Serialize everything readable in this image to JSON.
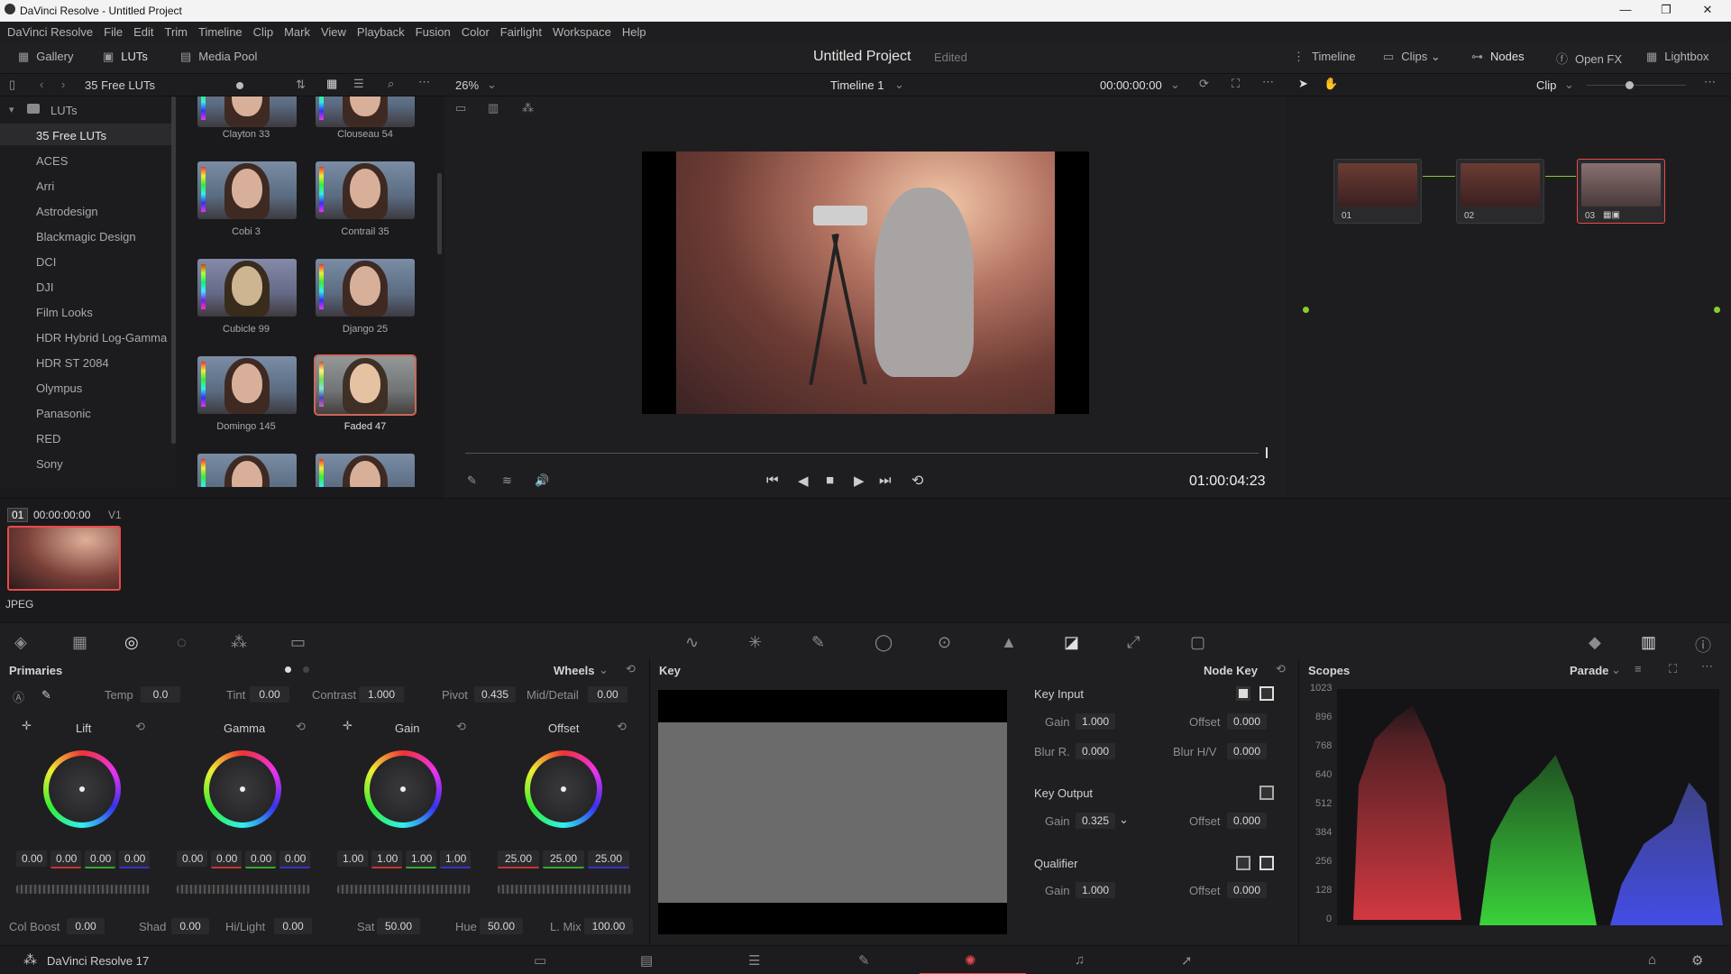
{
  "window": {
    "title": "DaVinci Resolve - Untitled Project",
    "minimize": "—",
    "maximize": "❐",
    "close": "✕"
  },
  "menu": [
    "DaVinci Resolve",
    "File",
    "Edit",
    "Trim",
    "Timeline",
    "Clip",
    "Mark",
    "View",
    "Playback",
    "Fusion",
    "Color",
    "Fairlight",
    "Workspace",
    "Help"
  ],
  "pagebar": {
    "gallery": "Gallery",
    "luts": "LUTs",
    "media_pool": "Media Pool",
    "project": "Untitled Project",
    "edited": "Edited",
    "timeline": "Timeline",
    "clips": "Clips",
    "nodes": "Nodes",
    "openfx": "Open FX",
    "lightbox": "Lightbox"
  },
  "subbar": {
    "lut_folder": "35 Free LUTs",
    "zoom": "26%",
    "timeline_name": "Timeline 1",
    "timecode": "00:00:00:00",
    "clip_mode": "Clip"
  },
  "lut_tree": {
    "root": "LUTs",
    "items": [
      "35 Free LUTs",
      "ACES",
      "Arri",
      "Astrodesign",
      "Blackmagic Design",
      "DCI",
      "DJI",
      "Film Looks",
      "HDR Hybrid Log-Gamma",
      "HDR ST 2084",
      "Olympus",
      "Panasonic",
      "RED",
      "Sony"
    ]
  },
  "lut_thumbs": [
    "Clayton 33",
    "Clouseau 54",
    "Cobi 3",
    "Contrail 35",
    "Cubicle 99",
    "Django 25",
    "Domingo 145",
    "Faded 47"
  ],
  "viewer": {
    "playhead_tc": "01:00:04:23"
  },
  "nodes": [
    "01",
    "02",
    "03"
  ],
  "clip": {
    "index": "01",
    "tc": "00:00:00:00",
    "track": "V1",
    "format": "JPEG"
  },
  "primaries": {
    "title": "Primaries",
    "mode": "Wheels",
    "temp_label": "Temp",
    "temp": "0.0",
    "tint_label": "Tint",
    "tint": "0.00",
    "contrast_label": "Contrast",
    "contrast": "1.000",
    "pivot_label": "Pivot",
    "pivot": "0.435",
    "middetail_label": "Mid/Detail",
    "middetail": "0.00",
    "wheels": [
      {
        "name": "Lift",
        "vals": [
          "0.00",
          "0.00",
          "0.00",
          "0.00"
        ]
      },
      {
        "name": "Gamma",
        "vals": [
          "0.00",
          "0.00",
          "0.00",
          "0.00"
        ]
      },
      {
        "name": "Gain",
        "vals": [
          "1.00",
          "1.00",
          "1.00",
          "1.00"
        ]
      },
      {
        "name": "Offset",
        "vals": [
          "25.00",
          "25.00",
          "25.00"
        ]
      }
    ],
    "colboost_label": "Col Boost",
    "colboost": "0.00",
    "shad_label": "Shad",
    "shad": "0.00",
    "hilight_label": "Hi/Light",
    "hilight": "0.00",
    "sat_label": "Sat",
    "sat": "50.00",
    "hue_label": "Hue",
    "hue": "50.00",
    "lmix_label": "L. Mix",
    "lmix": "100.00"
  },
  "key": {
    "title": "Key",
    "node_key": "Node Key",
    "key_input": "Key Input",
    "gain_label": "Gain",
    "offset_label": "Offset",
    "ki_gain": "1.000",
    "ki_offset": "0.000",
    "blur_r_label": "Blur R.",
    "blur_r": "0.000",
    "blur_hv_label": "Blur H/V",
    "blur_hv": "0.000",
    "key_output": "Key Output",
    "ko_gain": "0.325",
    "ko_offset": "0.000",
    "qualifier": "Qualifier",
    "q_gain": "1.000",
    "q_offset": "0.000"
  },
  "scopes": {
    "title": "Scopes",
    "mode": "Parade",
    "ticks": [
      "1023",
      "896",
      "768",
      "640",
      "512",
      "384",
      "256",
      "128",
      "0"
    ]
  },
  "app": {
    "name": "DaVinci Resolve 17"
  },
  "colors": {
    "accent": "#e64b4b",
    "bg": "#1f1f21"
  }
}
